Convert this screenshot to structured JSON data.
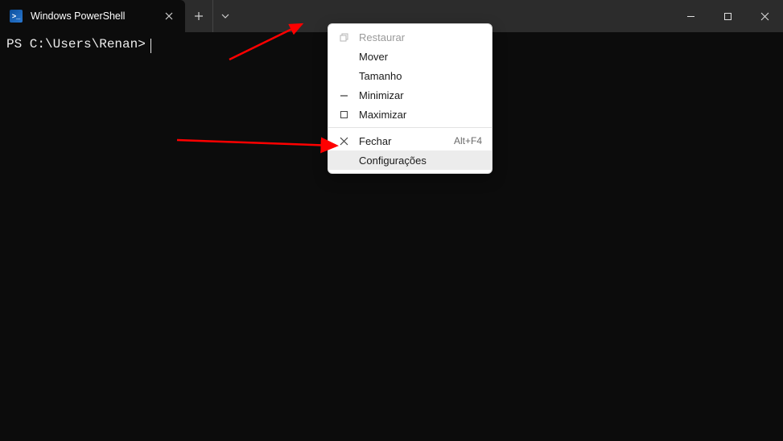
{
  "tab": {
    "title": "Windows PowerShell",
    "icon": "powershell-icon"
  },
  "terminal": {
    "prompt": "PS C:\\Users\\Renan>"
  },
  "menu": {
    "restore": "Restaurar",
    "move": "Mover",
    "size": "Tamanho",
    "minimize": "Minimizar",
    "maximize": "Maximizar",
    "close": "Fechar",
    "close_shortcut": "Alt+F4",
    "settings": "Configurações"
  }
}
